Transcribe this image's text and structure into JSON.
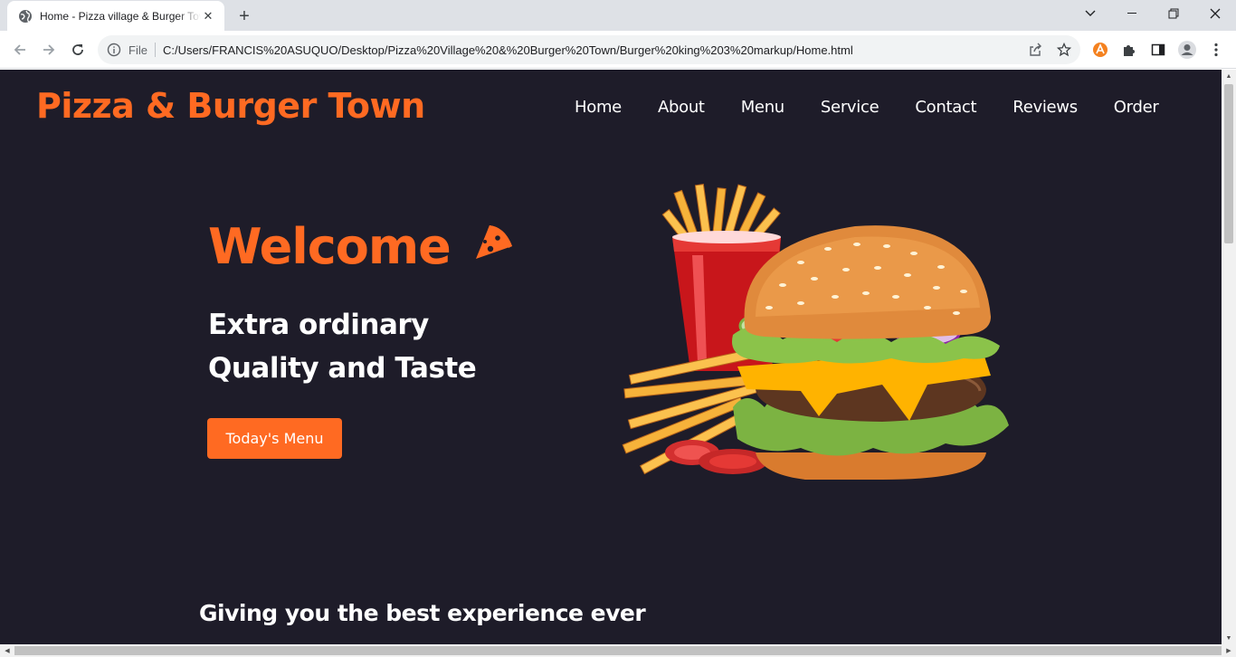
{
  "browser": {
    "tab_title": "Home - Pizza village & Burger Town",
    "omnibox_scheme_label": "File",
    "url": "C:/Users/FRANCIS%20ASUQUO/Desktop/Pizza%20Village%20&%20Burger%20Town/Burger%20king%203%20markup/Home.html"
  },
  "site": {
    "logo": "Pizza & Burger Town",
    "nav": [
      "Home",
      "About",
      "Menu",
      "Service",
      "Contact",
      "Reviews",
      "Order"
    ],
    "hero": {
      "welcome": "Welcome",
      "tagline_line1": "Extra ordinary",
      "tagline_line2": "Quality and Taste",
      "cta": "Today's Menu",
      "image": "burger-fries-soda-illustration"
    },
    "section_heading": "Giving you the best experience ever"
  },
  "colors": {
    "accent": "#ff6a22",
    "background": "#1e1c29",
    "text": "#ffffff"
  }
}
